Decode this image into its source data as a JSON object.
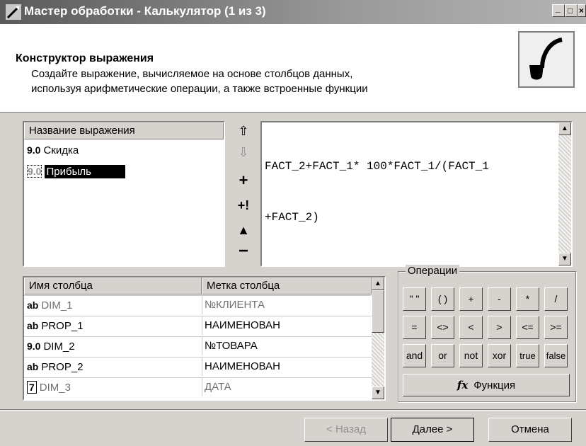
{
  "window": {
    "title": "Мастер обработки - Калькулятор (1 из 3)",
    "min_glyph": "_",
    "max_glyph": "□",
    "close_glyph": "×"
  },
  "header": {
    "title": "Конструктор выражения",
    "description_line1": "Создайте выражение, вычисляемое на основе столбцов данных,",
    "description_line2": "используя арифметические операции, а также встроенные функции"
  },
  "expressions": {
    "column_header": "Название выражения",
    "items": [
      {
        "badge": "9.0",
        "label": "Скидка",
        "selected": false
      },
      {
        "badge": "9.0",
        "label": "Прибыль",
        "selected": true
      }
    ]
  },
  "expression_tools": {
    "up_glyph": "⇧",
    "down_glyph": "⇩",
    "add_glyph": "+",
    "add_excl_glyph": "+!",
    "move_glyph": "▲",
    "remove_glyph": "−"
  },
  "editor": {
    "line1": "FACT_2+FACT_1* 100*FACT_1/(FACT_1",
    "line2": "+FACT_2)"
  },
  "columns": {
    "header_name": "Имя столбца",
    "header_label": "Метка столбца",
    "rows": [
      {
        "badge": "ab",
        "name": "DIM_1",
        "label": "№КЛИЕНТА",
        "dim": true
      },
      {
        "badge": "ab",
        "name": "PROP_1",
        "label": "НАИМЕНОВАН",
        "dim": false
      },
      {
        "badge": "9.0",
        "name": "DIM_2",
        "label": "№ТОВАРА",
        "dim": false
      },
      {
        "badge": "ab",
        "name": "PROP_2",
        "label": "НАИМЕНОВАН",
        "dim": false
      },
      {
        "badge": "7",
        "name": "DIM_3",
        "label": "ДАТА",
        "dim": true
      }
    ]
  },
  "operations": {
    "legend": "Операции",
    "row1": [
      "\" \"",
      "( )",
      "+",
      "-",
      "*",
      "/"
    ],
    "row2": [
      "=",
      "<>",
      "<",
      ">",
      "<=",
      ">="
    ],
    "row3": [
      "and",
      "or",
      "not",
      "xor",
      "true",
      "false"
    ],
    "function_icon": "fx",
    "function_label": "Функция"
  },
  "footer": {
    "back_label": "< Назад",
    "next_label": "Далее >",
    "cancel_label": "Отмена"
  }
}
